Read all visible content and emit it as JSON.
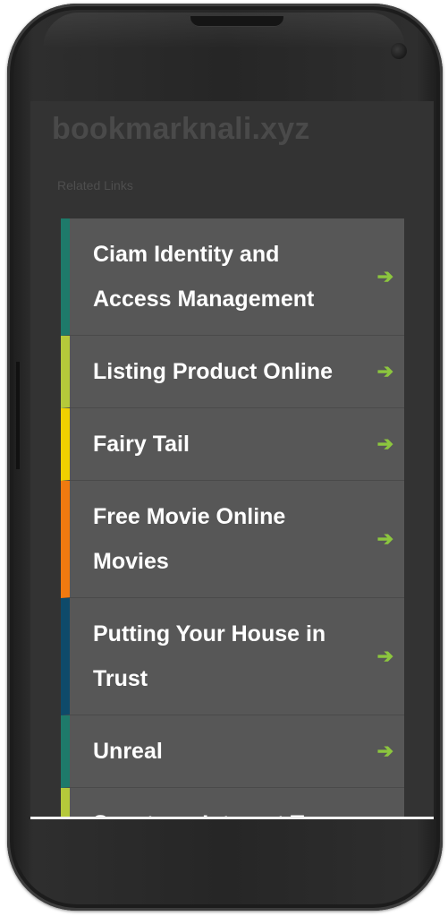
{
  "site": {
    "title": "bookmarknali.xyz",
    "section_label": "Related Links"
  },
  "links": [
    {
      "label": "Ciam Identity and Access Management",
      "accent": "#1e7a6a",
      "icon": "arrow-right-icon"
    },
    {
      "label": "Listing Product Online",
      "accent": "#b5c93a",
      "icon": "arrow-right-icon"
    },
    {
      "label": "Fairy Tail",
      "accent": "#f0d000",
      "icon": "arrow-right-icon"
    },
    {
      "label": "Free Movie Online Movies",
      "accent": "#f07a10",
      "icon": "arrow-right-icon"
    },
    {
      "label": "Putting Your House in Trust",
      "accent": "#0e4a6a",
      "icon": "arrow-right-icon"
    },
    {
      "label": "Unreal",
      "accent": "#1e7a6a",
      "icon": "arrow-right-icon"
    },
    {
      "label": "Spectrum Internet Tv",
      "accent": "#b5c93a",
      "icon": "arrow-right-icon"
    }
  ],
  "colors": {
    "screen_background": "#333333",
    "item_background": "#575757",
    "arrow": "#8cc63e"
  }
}
